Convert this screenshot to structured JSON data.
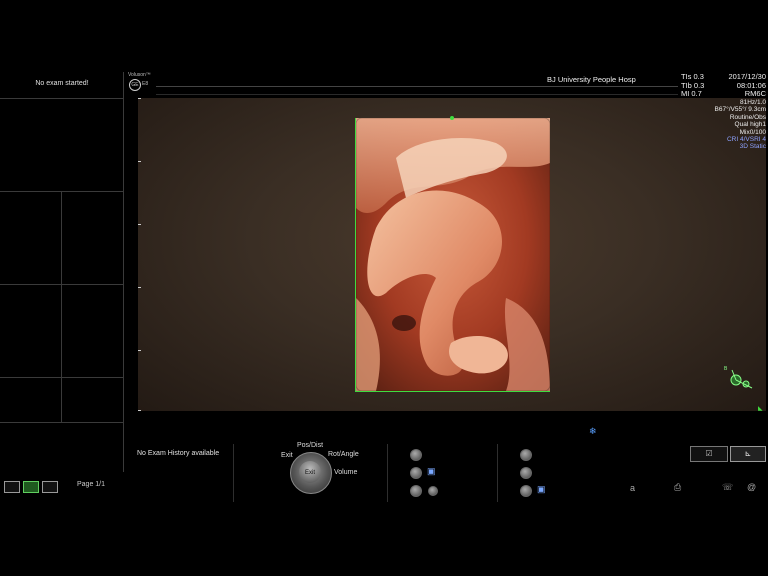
{
  "left_panel": {
    "exam_status": "No exam started!",
    "page_label": "Page 1/1",
    "layout_buttons": [
      "single",
      "dual",
      "quad"
    ]
  },
  "header": {
    "logo_text": "Voluson™",
    "logo_mark": "GE",
    "logo_sub": "E8",
    "hospital": "BJ  University  People Hosp",
    "tis_lines": [
      "TIs   0.3",
      "TIb   0.3",
      "MI    0.7"
    ],
    "date_lines": [
      "2017/12/30",
      "08:01:06",
      "RM6C"
    ]
  },
  "params": [
    {
      "text": "81Hz/1.0",
      "color": "#eeeeee"
    },
    {
      "text": "B67°/V55°/ 9.3cm",
      "color": "#eeeeee"
    },
    {
      "text": "Routine/Obs",
      "color": "#eeeeee"
    },
    {
      "text": "Qual high1",
      "color": "#eeeeee"
    },
    {
      "text": "Mix0/100",
      "color": "#eeeeee"
    },
    {
      "text": "CRI 4/VSRI 4",
      "color": "#8ea2ff"
    },
    {
      "text": "3D Static",
      "color": "#8ea2ff"
    }
  ],
  "bottom": {
    "history": "No Exam History available",
    "trackball": {
      "center": "Exit",
      "top": "Pos/Dist",
      "left": "Exit",
      "right": "Rot/Angle",
      "bottom_right": "Volume"
    },
    "letter_a": "a",
    "tab_right1_icon": "checkbox-icon",
    "tab_right2_icon": "chart-icon"
  },
  "icons": {
    "freeze": "snowflake-icon",
    "orientation": "orientation-marker-icon",
    "save": "save-icon",
    "printer": "printer-icon",
    "phone": "phone-icon",
    "settings": "settings-icon"
  }
}
